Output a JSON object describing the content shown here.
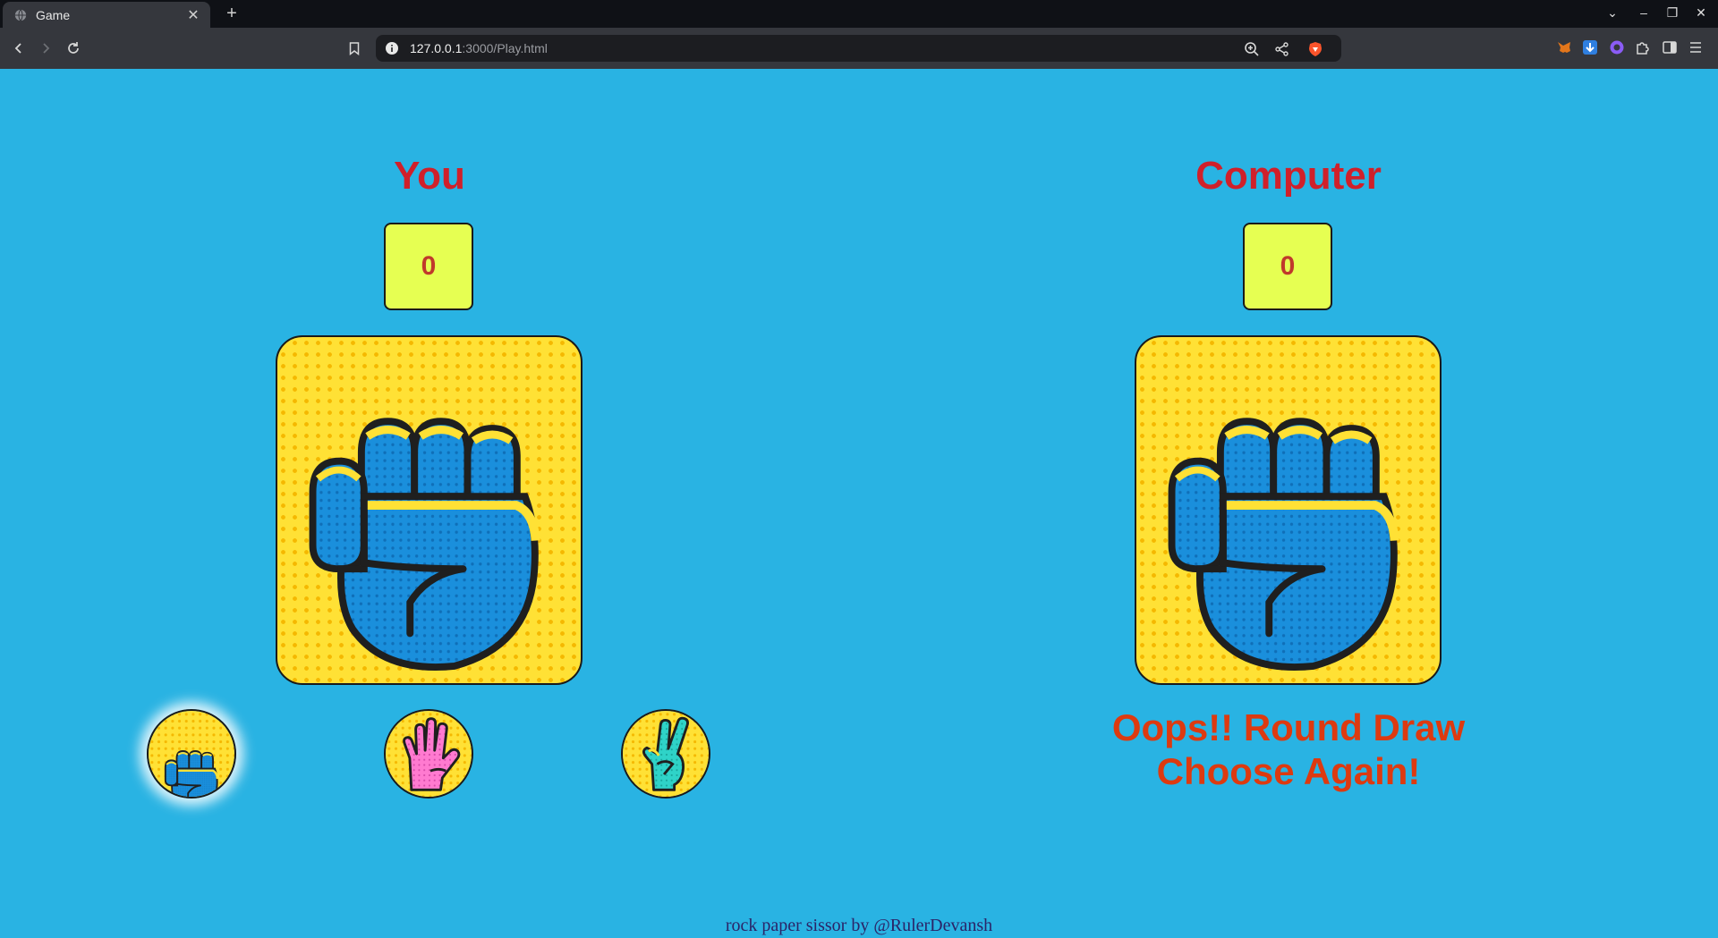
{
  "browser": {
    "tab_title": "Game",
    "tab_close": "✕",
    "new_tab": "+",
    "url_host": "127.0.0.1",
    "url_rest": ":3000/Play.html",
    "window_controls": [
      "⌄",
      "–",
      "❐",
      "✕"
    ]
  },
  "game": {
    "player": {
      "name": "You",
      "score": "0",
      "current_choice": "rock"
    },
    "computer": {
      "name": "Computer",
      "score": "0",
      "current_choice": "rock"
    },
    "choices": [
      {
        "name": "rock",
        "icon": "fist-icon",
        "selected": true
      },
      {
        "name": "paper",
        "icon": "open-hand-icon",
        "selected": false
      },
      {
        "name": "scissors",
        "icon": "peace-hand-icon",
        "selected": false
      }
    ],
    "result_line1": "Oops!! Round Draw",
    "result_line2": "Choose Again!"
  },
  "footer": {
    "text": "rock paper sissor by @RulerDevansh"
  },
  "colors": {
    "background": "#29b3e3",
    "name": "#d0202a",
    "score_box": "#e6ff52",
    "result": "#dd3a10",
    "card": "#ffe135",
    "hand_blue": "#1a8fdc"
  }
}
